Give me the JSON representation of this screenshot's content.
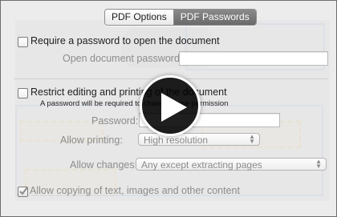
{
  "tabs": [
    {
      "label": "PDF Options",
      "active": false
    },
    {
      "label": "PDF Passwords",
      "active": true
    }
  ],
  "require_open_password": {
    "label": "Require a password to open the document",
    "checked": false
  },
  "open_password_field": {
    "label": "Open document password:",
    "value": ""
  },
  "restrict_editing": {
    "label": "Restrict editing and printing of the document",
    "checked": false,
    "note": "A password will be required to change these permission"
  },
  "password_field": {
    "label": "Password:",
    "value": ""
  },
  "allow_printing": {
    "label": "Allow printing:",
    "selected": "High resolution"
  },
  "allow_changes": {
    "label": "Allow changes:",
    "selected": "Any except extracting pages"
  },
  "allow_copying": {
    "label": "Allow copying of text, images and other content",
    "checked": true
  },
  "play_button": {
    "icon": "play-icon"
  },
  "colors": {
    "accent_tab": "#7a7a7a",
    "play_bg": "#000000"
  }
}
